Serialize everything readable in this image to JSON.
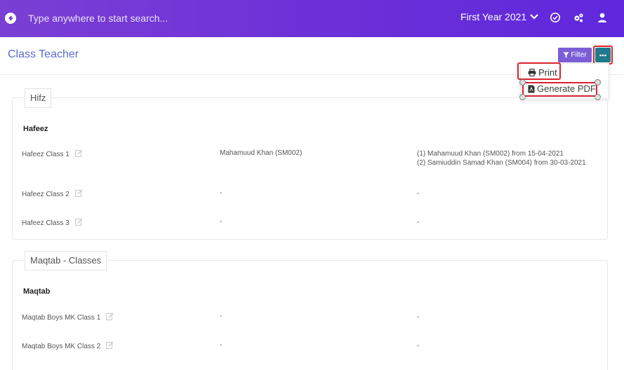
{
  "topbar": {
    "search_placeholder": "Type anywhere to start search...",
    "year_label": "First Year 2021",
    "icons": [
      "back-arrow-icon",
      "chevron-down-icon",
      "check-circle-icon",
      "cogs-icon",
      "user-icon"
    ]
  },
  "header": {
    "title": "Class Teacher",
    "filter_label": "Filter",
    "menu": {
      "print_label": "Print",
      "pdf_label": "Generate PDF"
    }
  },
  "groups": [
    {
      "legend": "Hifz",
      "subheading": "Hafeez",
      "rows": [
        {
          "name": "Hafeez Class 1",
          "teacher": "Mahamuud Khan (SM002)",
          "history": [
            "(1) Mahamuud Khan (SM002) from 15-04-2021",
            "(2) Samiuddin Samad Khan (SM004) from 30-03-2021"
          ]
        },
        {
          "name": "Hafeez Class 2",
          "teacher": "-",
          "history": [
            "-"
          ]
        },
        {
          "name": "Hafeez Class 3",
          "teacher": "-",
          "history": [
            "-"
          ]
        }
      ]
    },
    {
      "legend": "Maqtab - Classes",
      "subheading": "Maqtab",
      "rows": [
        {
          "name": "Maqtab Boys MK Class 1",
          "teacher": "-",
          "history": [
            "-"
          ]
        },
        {
          "name": "Maqtab Boys MK Class 2",
          "teacher": "-",
          "history": [
            "-"
          ]
        }
      ]
    }
  ],
  "colors": {
    "topbar": "#6a2fd8",
    "title": "#5b6bd1",
    "filter": "#7b5ed6",
    "more": "#1f7a8c",
    "highlight": "#d9232b"
  }
}
